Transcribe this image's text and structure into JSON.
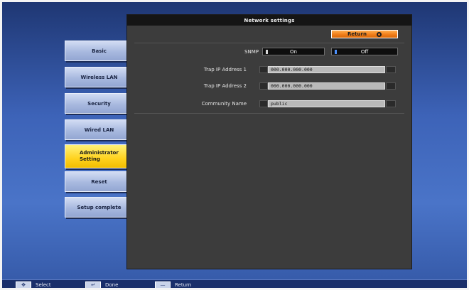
{
  "window": {
    "title": "Network settings",
    "return_label": "Return"
  },
  "sidebar": {
    "items": [
      {
        "label": "Basic"
      },
      {
        "label": "Wireless LAN"
      },
      {
        "label": "Security"
      },
      {
        "label": "Wired LAN"
      },
      {
        "label": "Administrator Setting",
        "selected": true
      },
      {
        "label": "Reset"
      },
      {
        "label": "Setup complete"
      }
    ]
  },
  "snmp": {
    "label": "SNMP",
    "options": [
      "On",
      "Off"
    ],
    "selected": "Off"
  },
  "fields": [
    {
      "label": "Trap IP Address 1",
      "value": "000.000.000.000"
    },
    {
      "label": "Trap IP Address 2",
      "value": "000.000.000.000"
    },
    {
      "label": "Community Name",
      "value": "public"
    }
  ],
  "footer": {
    "hints": [
      {
        "icon": "dpad-icon",
        "label": "Select"
      },
      {
        "icon": "enter-icon",
        "label": "Done"
      },
      {
        "icon": "esc-icon",
        "label": "Return"
      }
    ]
  },
  "colors": {
    "accent_selected": "#ffd21e",
    "return_button": "#ef7a16",
    "toggle_active": "#4e92ff"
  }
}
